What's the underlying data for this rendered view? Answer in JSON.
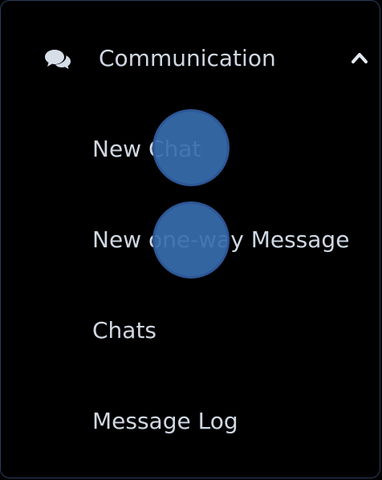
{
  "menu": {
    "header": {
      "icon": "chat-bubbles-icon",
      "title": "Communication",
      "chevron": "chevron-up-icon"
    },
    "items": [
      {
        "label": "New Chat"
      },
      {
        "label": "New one-way Message"
      },
      {
        "label": "Chats"
      },
      {
        "label": "Message Log"
      }
    ]
  },
  "colors": {
    "background": "#000000",
    "text": "#cfd8e3",
    "border": "#2a3e5e",
    "touch_marker": "#376eaf"
  }
}
